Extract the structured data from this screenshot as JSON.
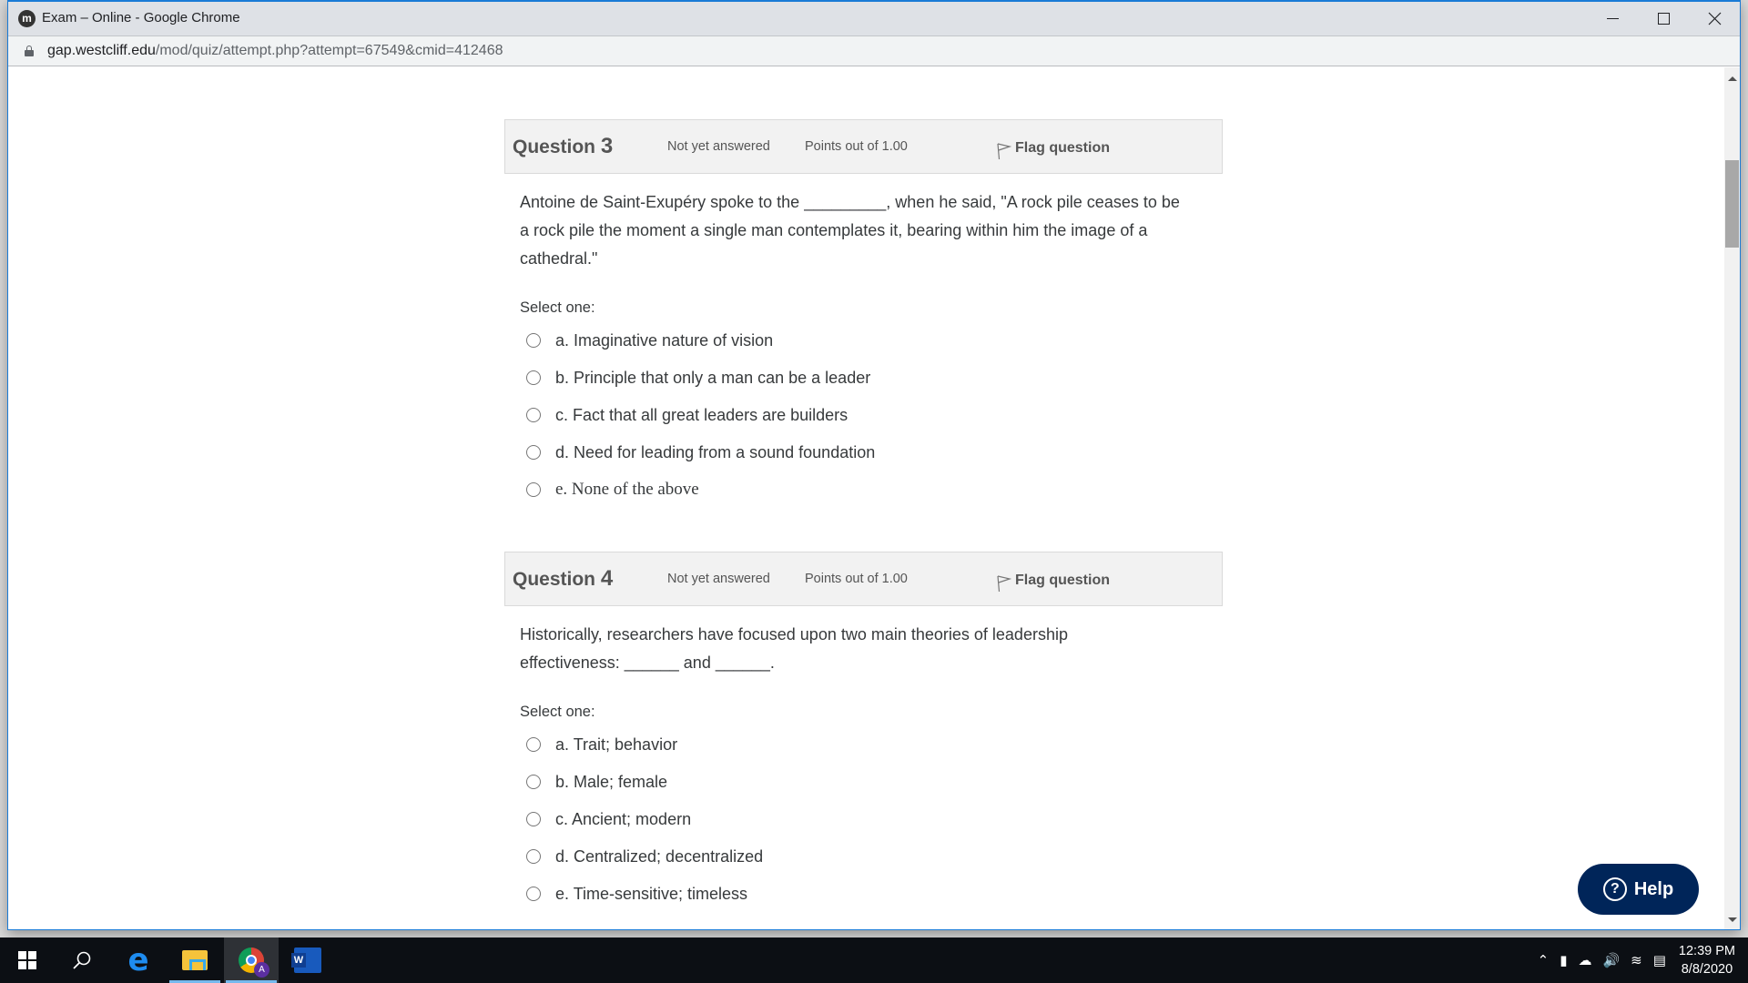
{
  "window": {
    "title": "Exam – Online - Google Chrome",
    "app_icon": "m",
    "url_domain": "gap.westcliff.edu",
    "url_path": "/mod/quiz/attempt.php?attempt=67549&cmid=412468"
  },
  "questions": [
    {
      "label": "Question",
      "number": "3",
      "state": "Not yet answered",
      "points": "Points out of 1.00",
      "flag_label": "Flag question",
      "text": "Antoine de Saint-Exupéry spoke to the _________, when he said, \"A rock pile ceases to be a rock pile the moment a single man contemplates it, bearing within him the image of a cathedral.\"",
      "select_prompt": "Select one:",
      "options": [
        "a. Imaginative nature of vision",
        "b. Principle that only a man can be a leader",
        "c. Fact that all great leaders are builders",
        "d. Need for leading from a sound foundation",
        "e. None of the above"
      ]
    },
    {
      "label": "Question",
      "number": "4",
      "state": "Not yet answered",
      "points": "Points out of 1.00",
      "flag_label": "Flag question",
      "text": "Historically, researchers have focused upon two main theories of leadership effectiveness: ______ and ______.",
      "select_prompt": "Select one:",
      "options": [
        "a. Trait; behavior",
        "b. Male; female",
        "c. Ancient; modern",
        "d. Centralized; decentralized",
        "e. Time-sensitive; timeless"
      ]
    }
  ],
  "help_button": {
    "label": "Help",
    "icon": "?"
  },
  "taskbar": {
    "chrome_profile_badge": "A",
    "word_label": "W",
    "time": "12:39 PM",
    "date": "8/8/2020"
  },
  "colors": {
    "help_bg": "#002559",
    "window_border": "#1a7bd6",
    "question_header_bg": "#f2f2f2"
  }
}
